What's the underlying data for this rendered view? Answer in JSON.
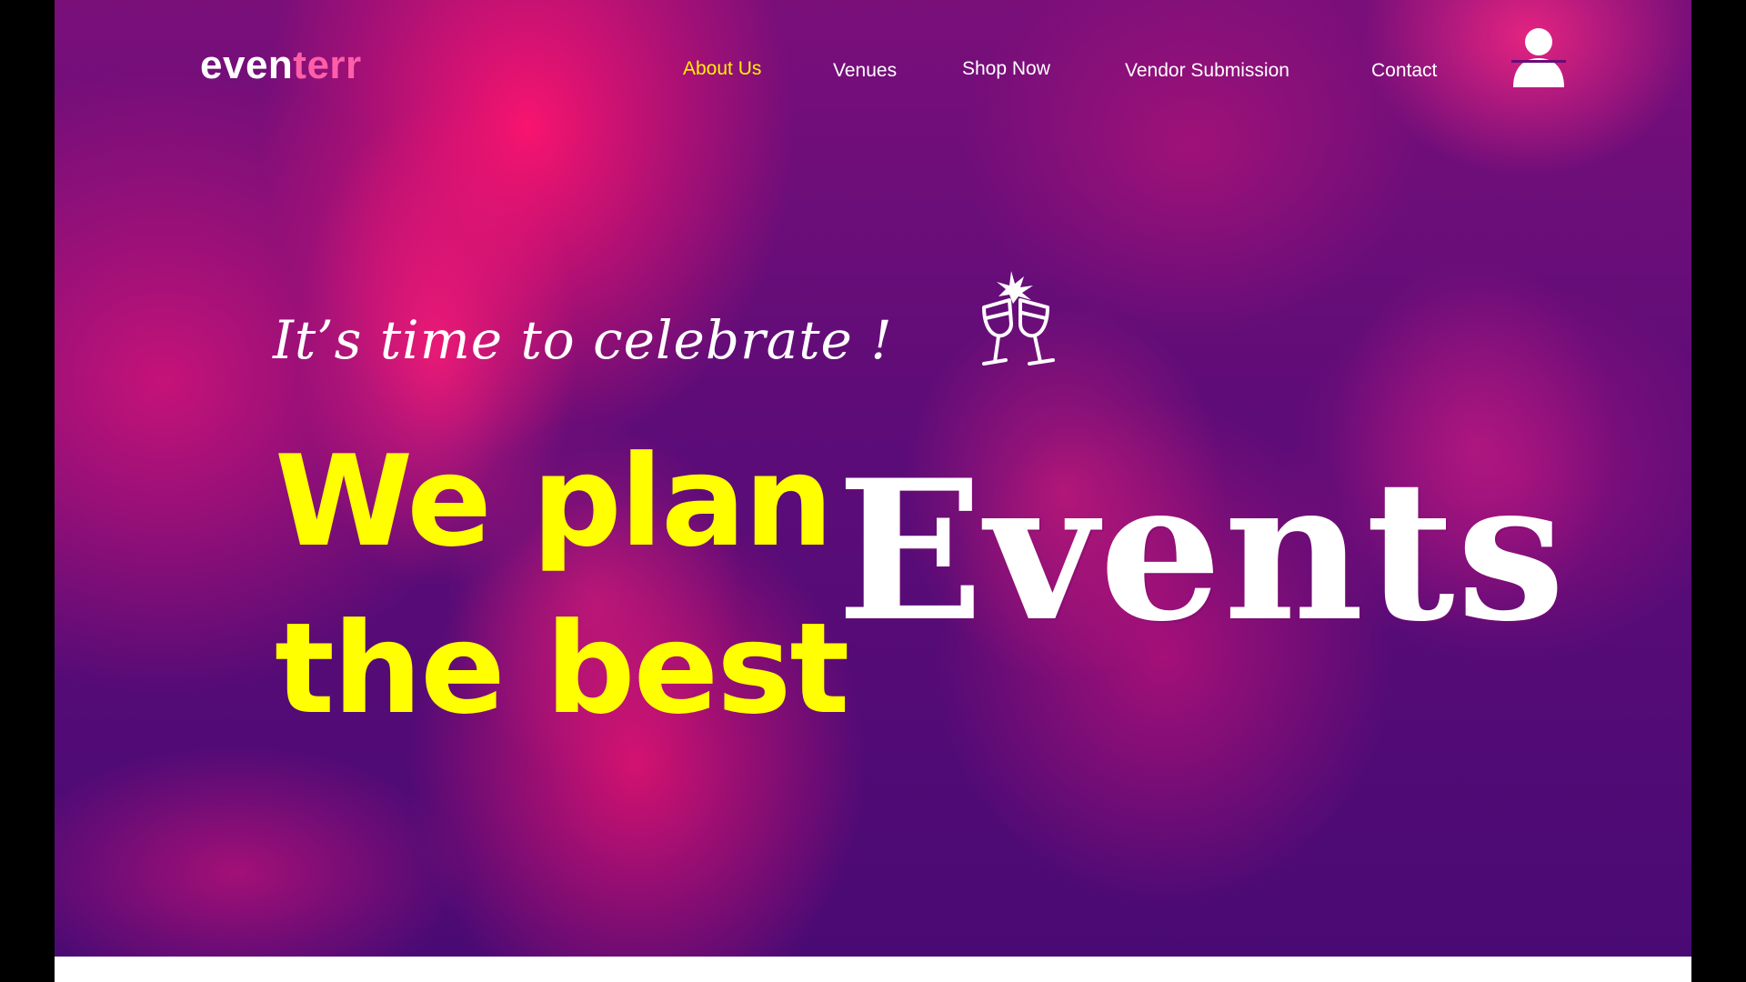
{
  "brand": {
    "logo_part1": "even",
    "logo_part2": "terr"
  },
  "nav": {
    "items": [
      {
        "label": "About Us",
        "active": true
      },
      {
        "label": "Venues",
        "active": false
      },
      {
        "label": "Shop Now",
        "active": false
      },
      {
        "label": "Vendor Submission",
        "active": false
      },
      {
        "label": "Contact",
        "active": false
      }
    ],
    "user_icon": "user-icon"
  },
  "hero": {
    "tagline": "It’s time to celebrate !",
    "tagline_icon": "cheers-glasses-icon",
    "headline_line1": "We plan",
    "headline_line2": "the best",
    "headline_accent": "Events"
  },
  "colors": {
    "accent_yellow": "#fff200",
    "overlay_pink": "#ff1470",
    "overlay_purple": "#4a0a74",
    "logo_pink": "#ff5fa8",
    "text_white": "#ffffff"
  }
}
